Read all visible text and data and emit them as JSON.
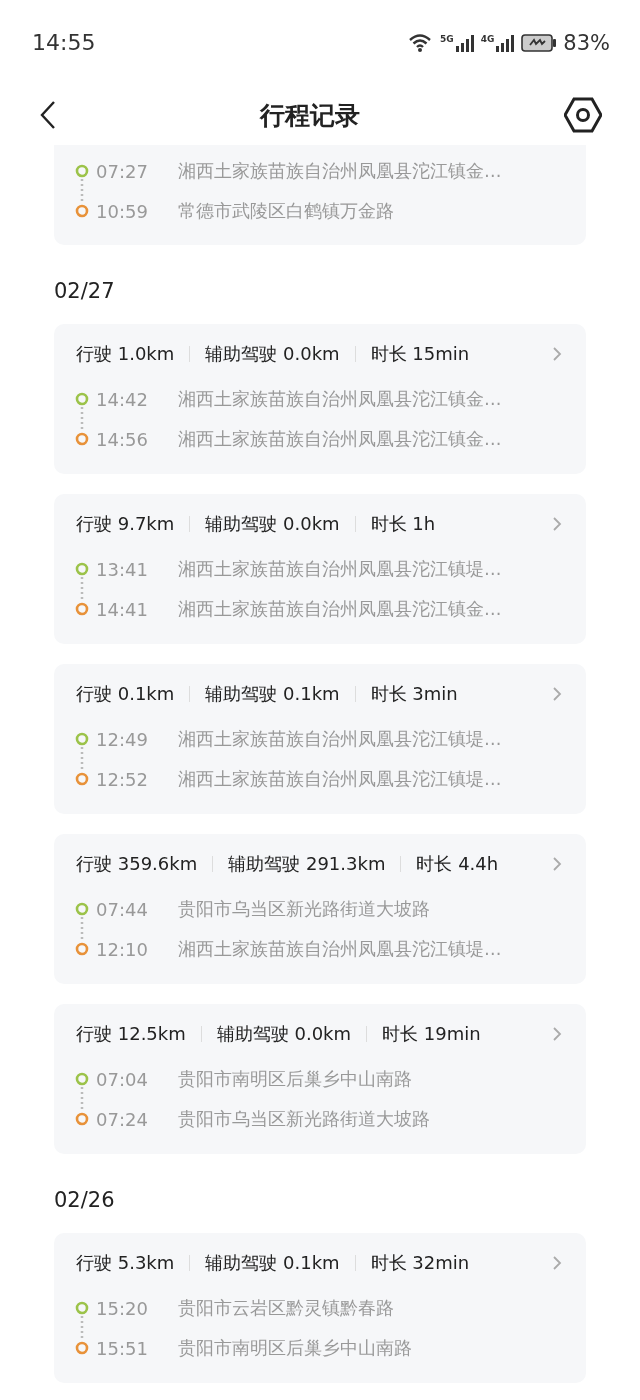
{
  "status_bar": {
    "time": "14:55",
    "network_labels": [
      "5G",
      "4G"
    ],
    "battery": "83%"
  },
  "header": {
    "title": "行程记录"
  },
  "groups": [
    {
      "trips": [
        {
          "stops": [
            {
              "kind": "start",
              "time": "07:27",
              "address": "湘西土家族苗族自治州凤凰县沱江镇金…"
            },
            {
              "kind": "end",
              "time": "10:59",
              "address": "常德市武陵区白鹤镇万金路"
            }
          ]
        }
      ]
    },
    {
      "date": "02/27",
      "trips": [
        {
          "stats": [
            "行驶 1.0km",
            "辅助驾驶 0.0km",
            "时长 15min"
          ],
          "stops": [
            {
              "kind": "start",
              "time": "14:42",
              "address": "湘西土家族苗族自治州凤凰县沱江镇金…"
            },
            {
              "kind": "end",
              "time": "14:56",
              "address": "湘西土家族苗族自治州凤凰县沱江镇金…"
            }
          ]
        },
        {
          "stats": [
            "行驶 9.7km",
            "辅助驾驶 0.0km",
            "时长 1h"
          ],
          "stops": [
            {
              "kind": "start",
              "time": "13:41",
              "address": "湘西土家族苗族自治州凤凰县沱江镇堤…"
            },
            {
              "kind": "end",
              "time": "14:41",
              "address": "湘西土家族苗族自治州凤凰县沱江镇金…"
            }
          ]
        },
        {
          "stats": [
            "行驶 0.1km",
            "辅助驾驶 0.1km",
            "时长 3min"
          ],
          "stops": [
            {
              "kind": "start",
              "time": "12:49",
              "address": "湘西土家族苗族自治州凤凰县沱江镇堤…"
            },
            {
              "kind": "end",
              "time": "12:52",
              "address": "湘西土家族苗族自治州凤凰县沱江镇堤…"
            }
          ]
        },
        {
          "stats": [
            "行驶 359.6km",
            "辅助驾驶 291.3km",
            "时长 4.4h"
          ],
          "stops": [
            {
              "kind": "start",
              "time": "07:44",
              "address": "贵阳市乌当区新光路街道大坡路"
            },
            {
              "kind": "end",
              "time": "12:10",
              "address": "湘西土家族苗族自治州凤凰县沱江镇堤…"
            }
          ]
        },
        {
          "stats": [
            "行驶 12.5km",
            "辅助驾驶 0.0km",
            "时长 19min"
          ],
          "stops": [
            {
              "kind": "start",
              "time": "07:04",
              "address": "贵阳市南明区后巢乡中山南路"
            },
            {
              "kind": "end",
              "time": "07:24",
              "address": "贵阳市乌当区新光路街道大坡路"
            }
          ]
        }
      ]
    },
    {
      "date": "02/26",
      "trips": [
        {
          "stats": [
            "行驶 5.3km",
            "辅助驾驶 0.1km",
            "时长 32min"
          ],
          "stops": [
            {
              "kind": "start",
              "time": "15:20",
              "address": "贵阳市云岩区黔灵镇黔春路"
            },
            {
              "kind": "end",
              "time": "15:51",
              "address": "贵阳市南明区后巢乡中山南路"
            }
          ]
        }
      ]
    }
  ]
}
